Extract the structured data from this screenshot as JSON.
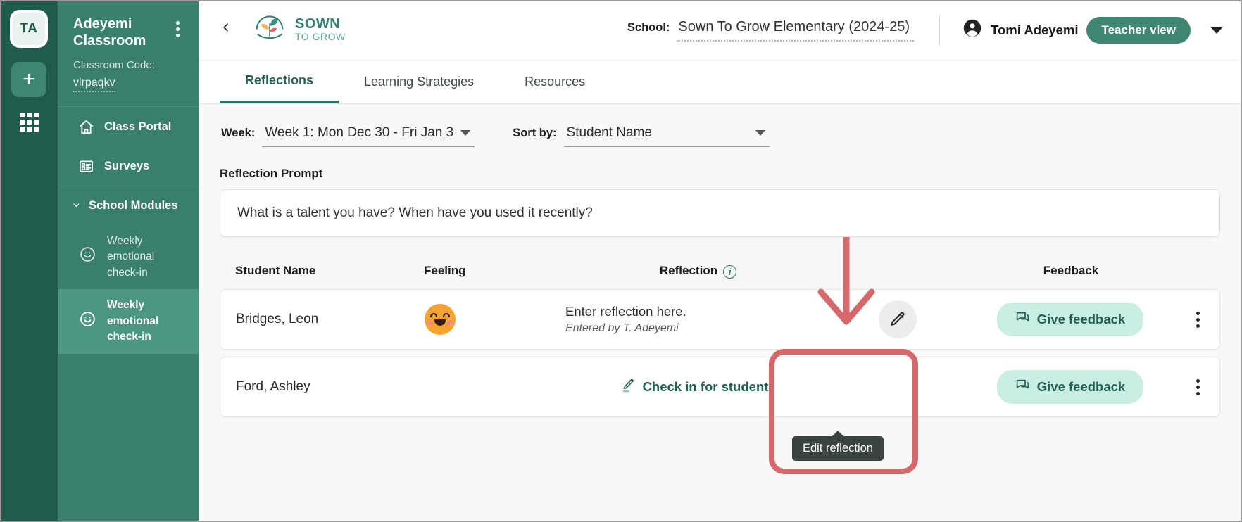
{
  "rail": {
    "avatar_initials": "TA",
    "add_label": "+",
    "apps_icon": "grid-apps-icon"
  },
  "sidebar": {
    "classroom_title": "Adeyemi Classroom",
    "kebab_icon": "kebab-menu-icon",
    "code_label": "Classroom Code:",
    "code_value": "vlrpaqkv",
    "nav": [
      {
        "label": "Class Portal",
        "icon": "home-icon"
      },
      {
        "label": "Surveys",
        "icon": "survey-icon"
      }
    ],
    "group": {
      "label": "School Modules",
      "chevron": "chevron-down-icon"
    },
    "modules": [
      {
        "label": "Weekly emotional check-in",
        "icon": "smiley-icon",
        "active": false
      },
      {
        "label": "Weekly emotional check-in",
        "icon": "smiley-icon",
        "active": true
      }
    ]
  },
  "topbar": {
    "back_icon": "chevron-left-icon",
    "brand_top": "SOWN",
    "brand_bottom": "TO GROW",
    "brand_logo_icon": "sown-to-grow-leaf-logo",
    "school_label": "School:",
    "school_value": "Sown To Grow Elementary (2024-25)",
    "user_icon": "account-circle-icon",
    "user_name": "Tomi Adeyemi",
    "role_pill": "Teacher view",
    "caret_icon": "caret-down-icon"
  },
  "tabs": [
    {
      "label": "Reflections",
      "active": true
    },
    {
      "label": "Learning Strategies",
      "active": false
    },
    {
      "label": "Resources",
      "active": false
    }
  ],
  "filters": {
    "week_label": "Week:",
    "week_value": "Week 1: Mon Dec 30 - Fri Jan 3",
    "sort_label": "Sort by:",
    "sort_value": "Student Name"
  },
  "prompt": {
    "label": "Reflection Prompt",
    "text": "What is a talent you have? When have you used it recently?"
  },
  "table": {
    "headers": {
      "student_name": "Student Name",
      "feeling": "Feeling",
      "reflection": "Reflection",
      "reflection_info_icon": "info-icon",
      "feedback": "Feedback"
    },
    "rows": [
      {
        "student_name": "Bridges, Leon",
        "feeling_emoji": "smiling-face-with-smiling-eyes",
        "reflection_text": "Enter reflection here.",
        "reflection_byline": "Entered by T. Adeyemi",
        "edit_icon": "pencil-edit-icon",
        "feedback_label": "Give feedback",
        "feedback_icon": "comment-feedback-icon",
        "menu_icon": "vertical-dots-menu-icon"
      },
      {
        "student_name": "Ford, Ashley",
        "checkin_label": "Check in for student",
        "checkin_icon": "pencil-underline-icon",
        "feedback_label": "Give feedback",
        "feedback_icon": "comment-feedback-icon",
        "menu_icon": "vertical-dots-menu-icon"
      }
    ]
  },
  "annotations": {
    "tooltip_text": "Edit reflection",
    "highlight_color": "#d4686b",
    "arrow_icon": "down-arrow-annotation"
  }
}
